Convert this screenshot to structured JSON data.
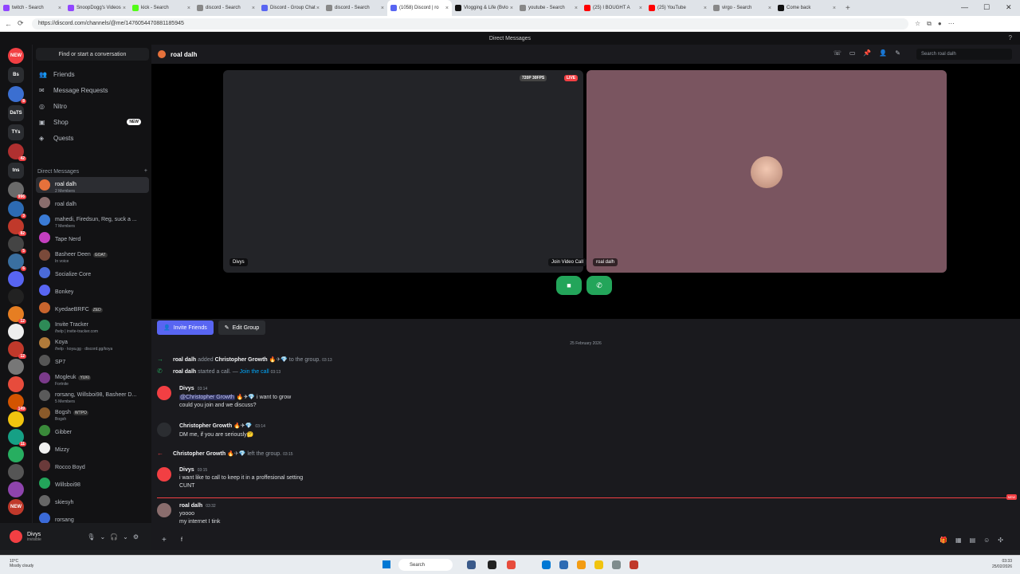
{
  "browser": {
    "tabs": [
      {
        "label": "twitch - Search",
        "color": "#9146ff"
      },
      {
        "label": "SnoopDogg's Videos",
        "color": "#9146ff"
      },
      {
        "label": "kick - Search",
        "color": "#53fc18"
      },
      {
        "label": "discord - Search",
        "color": "#888888"
      },
      {
        "label": "Discord - Group Chat",
        "color": "#5865f2"
      },
      {
        "label": "discord - Search",
        "color": "#888888"
      },
      {
        "label": "(1058) Discord | ro",
        "color": "#5865f2"
      },
      {
        "label": "Vlogging & Life (Bvlo",
        "color": "#111111"
      },
      {
        "label": "youtube - Search",
        "color": "#888888"
      },
      {
        "label": "(25) I BOUGHT A",
        "color": "#ff0000"
      },
      {
        "label": "(25) YouTube",
        "color": "#ff0000"
      },
      {
        "label": "virgo - Search",
        "color": "#888888"
      },
      {
        "label": "Come back",
        "color": "#111111"
      }
    ],
    "active_tab": 6,
    "new_tab": "+",
    "url": "https://discord.com/channels/@me/1476054470881185945",
    "window_controls": [
      "—",
      "☐",
      "✕"
    ]
  },
  "discord": {
    "title": "Direct Messages",
    "servers": [
      {
        "label": "NEW",
        "color": "#f23f43",
        "badge": ""
      },
      {
        "label": "Bs",
        "color": "#2b2d31",
        "badge": ""
      },
      {
        "label": "",
        "color": "#3b6fd1",
        "badge": "8"
      },
      {
        "label": "DaTS",
        "color": "#2b2d31",
        "badge": ""
      },
      {
        "label": "TYs",
        "color": "#2b2d31",
        "badge": ""
      },
      {
        "label": "",
        "color": "#b03030",
        "badge": "42"
      },
      {
        "label": "tns",
        "color": "#2b2d31",
        "badge": ""
      },
      {
        "label": "",
        "color": "#6a6a6a",
        "badge": "996"
      },
      {
        "label": "",
        "color": "#2d6bb3",
        "badge": "3"
      },
      {
        "label": "",
        "color": "#c0392b",
        "badge": "82"
      },
      {
        "label": "",
        "color": "#444",
        "badge": "5"
      },
      {
        "label": "",
        "color": "#3a6fa0",
        "badge": "6"
      },
      {
        "label": "",
        "color": "#5865f2",
        "badge": ""
      },
      {
        "label": "",
        "color": "#222",
        "badge": ""
      },
      {
        "label": "",
        "color": "#e67e22",
        "badge": "12"
      },
      {
        "label": "",
        "color": "#eeeeee",
        "badge": ""
      },
      {
        "label": "",
        "color": "#c0392b",
        "badge": "12"
      },
      {
        "label": "",
        "color": "#777",
        "badge": ""
      },
      {
        "label": "",
        "color": "#e74c3c",
        "badge": ""
      },
      {
        "label": "",
        "color": "#d35400",
        "badge": "149"
      },
      {
        "label": "",
        "color": "#f1c40f",
        "badge": ""
      },
      {
        "label": "",
        "color": "#16a085",
        "badge": "11"
      },
      {
        "label": "",
        "color": "#27ae60",
        "badge": ""
      },
      {
        "label": "",
        "color": "#555",
        "badge": ""
      },
      {
        "label": "",
        "color": "#8e44ad",
        "badge": ""
      },
      {
        "label": "NEW",
        "color": "#c0392b",
        "badge": ""
      }
    ],
    "find_placeholder": "Find or start a conversation",
    "nav": [
      {
        "icon": "friends-icon",
        "glyph": "👥",
        "label": "Friends"
      },
      {
        "icon": "message-requests-icon",
        "glyph": "✉",
        "label": "Message Requests"
      },
      {
        "icon": "nitro-icon",
        "glyph": "◎",
        "label": "Nitro"
      },
      {
        "icon": "shop-icon",
        "glyph": "▣",
        "label": "Shop",
        "badge": "NEW"
      },
      {
        "icon": "quests-icon",
        "glyph": "◈",
        "label": "Quests"
      }
    ],
    "dm_header": "Direct Messages",
    "dm_add": "+",
    "dms": [
      {
        "name": "roal dalh",
        "sub": "2 Members",
        "color": "#e6713b",
        "tag": ""
      },
      {
        "name": "roal dalh",
        "sub": "",
        "color": "#8a6d6d",
        "tag": ""
      },
      {
        "name": "mahedi, Firedsun, Reg, suck a ...",
        "sub": "7 Members",
        "color": "#3a7bd5",
        "tag": ""
      },
      {
        "name": "Tape Nerd",
        "sub": "",
        "color": "#c43fbf",
        "tag": ""
      },
      {
        "name": "Basheer Deen",
        "sub": "In voice",
        "color": "#7a4a3a",
        "tag": "GOAT"
      },
      {
        "name": "Socialize Core",
        "sub": "",
        "color": "#4a6ad8",
        "tag": ""
      },
      {
        "name": "Bonkey",
        "sub": "",
        "color": "#5865f2",
        "tag": ""
      },
      {
        "name": "KyedaeBRFC",
        "sub": "",
        "color": "#c8642d",
        "tag": "ZED"
      },
      {
        "name": "Invite Tracker",
        "sub": "/help | invite-tracker.com",
        "color": "#2e8b57",
        "tag": ""
      },
      {
        "name": "Koya",
        "sub": "/help · koya.gg · discord.gg/koya",
        "color": "#b07a3a",
        "tag": ""
      },
      {
        "name": "SP7",
        "sub": "",
        "color": "#555",
        "tag": ""
      },
      {
        "name": "Mogleuk",
        "sub": "Fortnite",
        "color": "#7a3a8a",
        "tag": "YUKI"
      },
      {
        "name": "rorsang, Willsboi98, Basheer D...",
        "sub": "5 Members",
        "color": "#5a5a5a",
        "tag": ""
      },
      {
        "name": "Bogsh",
        "sub": "Bogsh",
        "color": "#8a5a2a",
        "tag": "WTPO"
      },
      {
        "name": "Gibber",
        "sub": "",
        "color": "#3a8a3a",
        "tag": ""
      },
      {
        "name": "Mizzy",
        "sub": "",
        "color": "#f0f0f0",
        "tag": ""
      },
      {
        "name": "Rocco Boyd",
        "sub": "",
        "color": "#6a3a3a",
        "tag": ""
      },
      {
        "name": "Willsboi98",
        "sub": "",
        "color": "#23a55a",
        "tag": ""
      },
      {
        "name": "skiesyh",
        "sub": "",
        "color": "#666",
        "tag": ""
      },
      {
        "name": "rorsang",
        "sub": "",
        "color": "#3a6ad8",
        "tag": ""
      },
      {
        "name": "Short guy67",
        "sub": "",
        "color": "#888",
        "tag": ""
      }
    ],
    "user": {
      "name": "Divys",
      "status": "invisible"
    },
    "channel": {
      "name": "roal dalh",
      "search_placeholder": "Search roal dalh"
    },
    "call": {
      "left_name": "Divys",
      "quality": "720P 30FPS",
      "live": "LIVE",
      "right_name": "roal dalh",
      "tooltip": "Join Video Call",
      "tile_color": "#7a5560"
    },
    "buttons": {
      "invite": "Invite Friends",
      "edit": "Edit Group"
    },
    "date_divider": "25 February 2026",
    "system_messages": [
      {
        "author": "roal dalh",
        "text1": "added",
        "target": "Christopher Growth",
        "text2": "to the group.",
        "time": "03:13"
      },
      {
        "author": "roal dalh",
        "text1": "started a call. —",
        "link": "Join the call",
        "time": "03:13"
      }
    ],
    "messages": [
      {
        "author": "Divys",
        "time": "03:14",
        "mention": "@Christopher Growth",
        "line1": "i want to grow",
        "line2": "could you join and we discuss?",
        "color": "#f23f43"
      },
      {
        "author": "Christopher Growth",
        "time": "03:14",
        "line1": "DM me, if you are seriously🤔",
        "line2": "",
        "color": "#2b2d31"
      },
      {
        "author": "Divys",
        "time": "03:15",
        "line1": "i want like to call to keep it in a proffesional setting",
        "line2": "CUNT",
        "color": "#f23f43"
      },
      {
        "author": "roal dalh",
        "time": "03:32",
        "line1": "yoooo",
        "line2": "my internet I tink",
        "color": "#8a6d6d"
      }
    ],
    "left_msg": {
      "author": "Christopher Growth",
      "text": "left the group.",
      "time": "03:15"
    },
    "new_tag": "NEW",
    "composer_text": "f"
  },
  "taskbar": {
    "weather_temp": "10°C",
    "weather_desc": "Mostly cloudy",
    "search": "Search",
    "time": "03:33",
    "date": "25/02/2026"
  }
}
